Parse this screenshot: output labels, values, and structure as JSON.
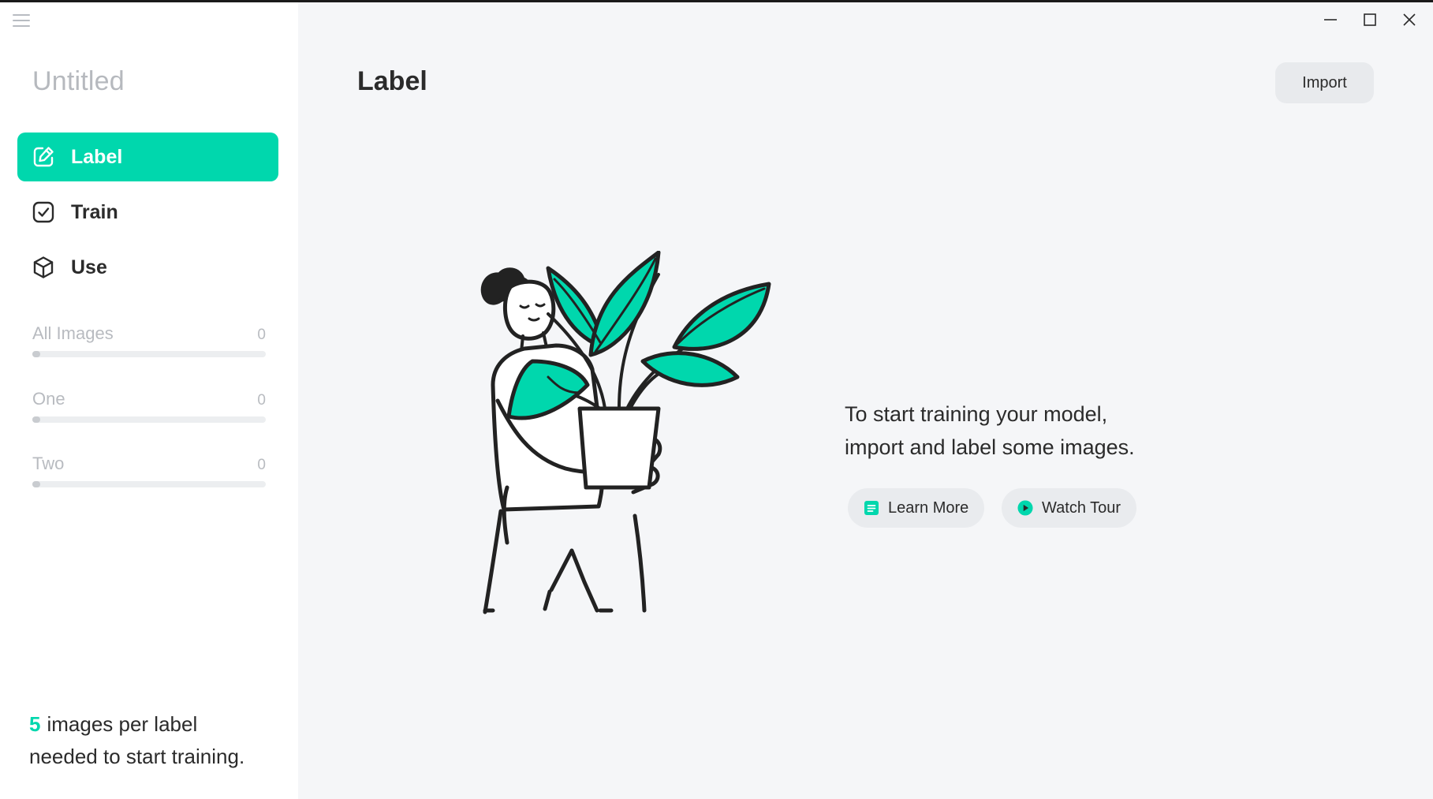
{
  "window": {
    "minimize_icon": "minimize-icon",
    "maximize_icon": "maximize-icon",
    "close_icon": "close-icon"
  },
  "sidebar": {
    "menu_icon": "hamburger-menu-icon",
    "project_title": "Untitled",
    "nav": [
      {
        "label": "Label",
        "icon": "edit-icon",
        "active": true
      },
      {
        "label": "Train",
        "icon": "checkbox-icon",
        "active": false
      },
      {
        "label": "Use",
        "icon": "cube-icon",
        "active": false
      }
    ],
    "stats": [
      {
        "name": "All Images",
        "count": "0",
        "progress": 0
      },
      {
        "name": "One",
        "count": "0",
        "progress": 0
      },
      {
        "name": "Two",
        "count": "0",
        "progress": 0
      }
    ],
    "footer": {
      "number": "5",
      "line1": "images per label",
      "line2": "needed to start training."
    }
  },
  "main": {
    "title": "Label",
    "import_label": "Import",
    "message_line1": "To start training your model,",
    "message_line2": "import and label some images.",
    "learn_more_label": "Learn More",
    "watch_tour_label": "Watch Tour"
  },
  "colors": {
    "accent": "#00d7ad",
    "sidebar_bg": "#ffffff",
    "main_bg": "#f5f6f8",
    "muted_text": "#b8bbc0"
  }
}
